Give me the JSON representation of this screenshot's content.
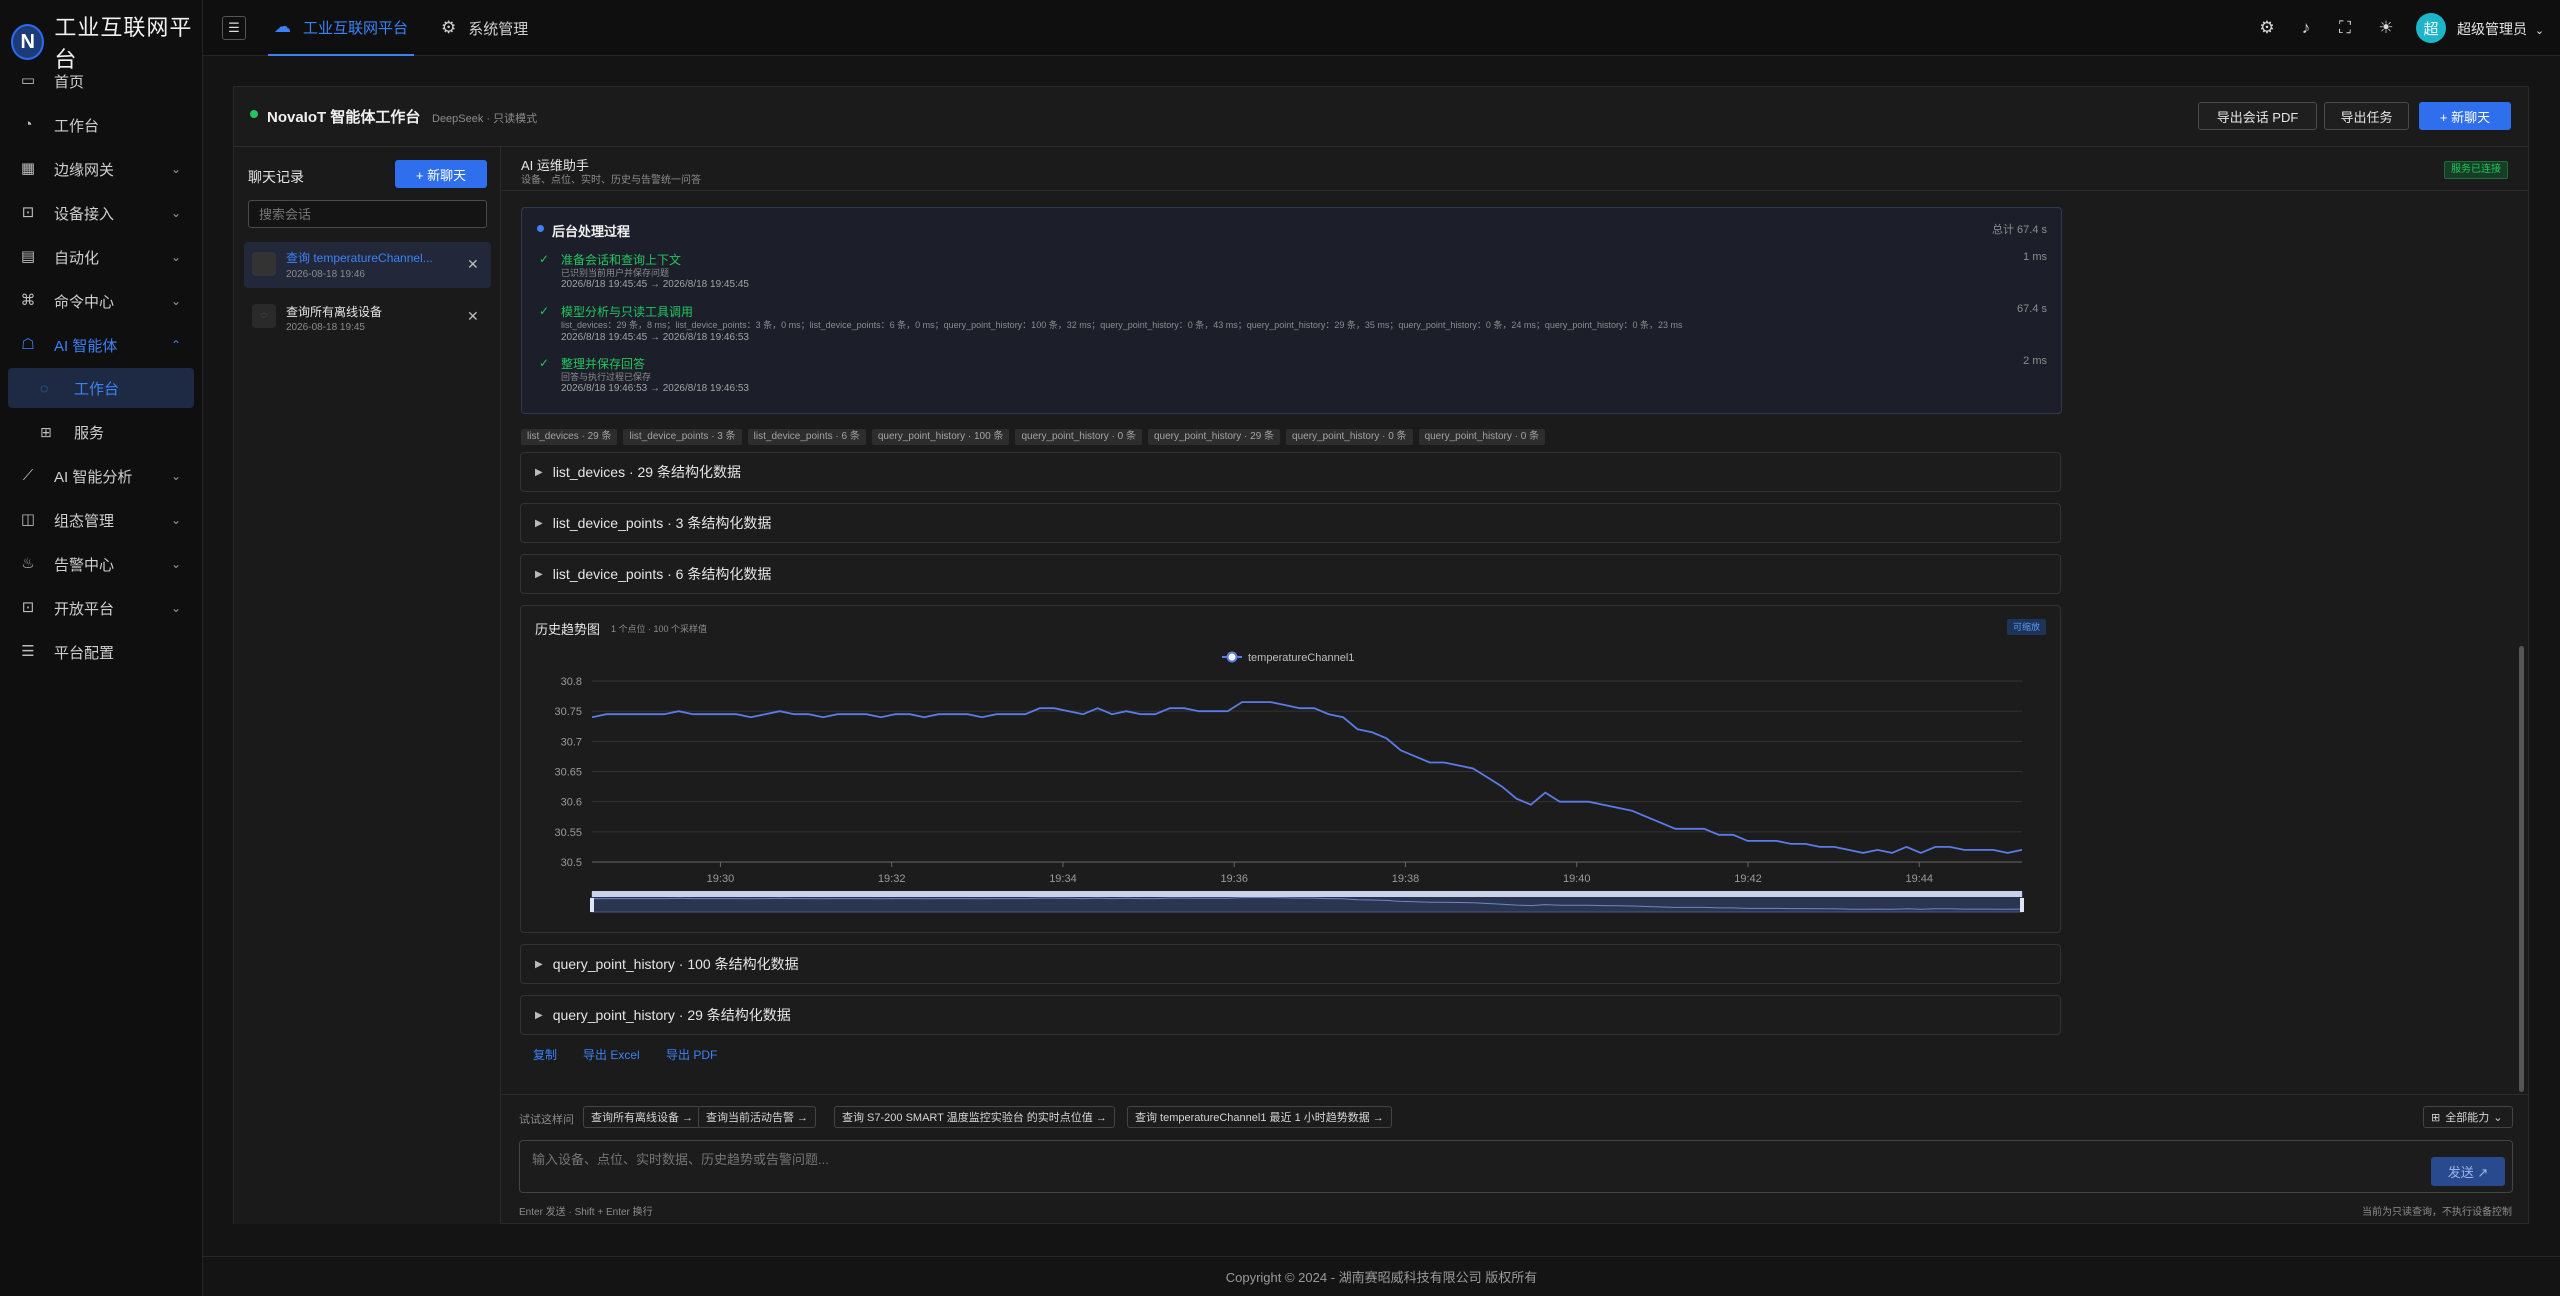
{
  "app": {
    "title": "工业互联网平台",
    "logo_letter": "N"
  },
  "sidebar": {
    "items": [
      {
        "label": "首页",
        "icon": "monitor-icon",
        "chevron": ""
      },
      {
        "label": "工作台",
        "icon": "dashboard-icon",
        "chevron": ""
      },
      {
        "label": "边缘网关",
        "icon": "gateway-icon",
        "chevron": "⌄"
      },
      {
        "label": "设备接入",
        "icon": "device-icon",
        "chevron": "⌄"
      },
      {
        "label": "自动化",
        "icon": "automation-icon",
        "chevron": "⌄"
      },
      {
        "label": "命令中心",
        "icon": "command-icon",
        "chevron": "⌄"
      },
      {
        "label": "AI 智能体",
        "icon": "robot-icon",
        "chevron": "⌃"
      },
      {
        "label": "AI 智能分析",
        "icon": "chart-line-icon",
        "chevron": "⌄"
      },
      {
        "label": "组态管理",
        "icon": "layout-icon",
        "chevron": "⌄"
      },
      {
        "label": "告警中心",
        "icon": "fire-icon",
        "chevron": "⌄"
      },
      {
        "label": "开放平台",
        "icon": "open-icon",
        "chevron": "⌄"
      },
      {
        "label": "平台配置",
        "icon": "sliders-icon",
        "chevron": ""
      }
    ],
    "sub_items": [
      {
        "label": "工作台",
        "icon": "chat-icon"
      },
      {
        "label": "服务",
        "icon": "service-icon"
      }
    ]
  },
  "topbar": {
    "tabs": [
      {
        "label": "工业互联网平台"
      },
      {
        "label": "系统管理"
      }
    ],
    "user": "超级管理员",
    "avatar_letter": "超"
  },
  "workspace": {
    "title": "NovaIoT 智能体工作台",
    "mode": "DeepSeek · 只读模式",
    "buttons": {
      "export_pdf": "导出会话 PDF",
      "export_task": "导出任务",
      "new_chat": "+ 新聊天"
    }
  },
  "chat_list": {
    "title": "聊天记录",
    "new_label": "+ 新聊天",
    "search_placeholder": "搜索会话",
    "items": [
      {
        "title": "查询 temperatureChannel...",
        "time": "2026-08-18 19:46"
      },
      {
        "title": "查询所有离线设备",
        "time": "2026-08-18 19:45"
      }
    ]
  },
  "assistant": {
    "title": "AI 运维助手",
    "subtitle": "设备、点位、实时、历史与告警统一问答",
    "status": "服务已连接"
  },
  "process": {
    "title": "后台处理过程",
    "total": "总计 67.4 s",
    "steps": [
      {
        "name": "准备会话和查询上下文",
        "desc": "已识别当前用户并保存问题",
        "time": "2026/8/18 19:45:45 → 2026/8/18 19:45:45",
        "duration": "1 ms"
      },
      {
        "name": "模型分析与只读工具调用",
        "desc": "list_devices：29 条，8 ms；list_device_points：3 条，0 ms；list_device_points：6 条，0 ms；query_point_history：100 条，32 ms；query_point_history：0 条，43 ms；query_point_history：29 条，35 ms；query_point_history：0 条，24 ms；query_point_history：0 条，23 ms",
        "time": "2026/8/18 19:45:45 → 2026/8/18 19:46:53",
        "duration": "67.4 s"
      },
      {
        "name": "整理并保存回答",
        "desc": "回答与执行过程已保存",
        "time": "2026/8/18 19:46:53 → 2026/8/18 19:46:53",
        "duration": "2 ms"
      }
    ]
  },
  "tool_chips": [
    "list_devices · 29 条",
    "list_device_points · 3 条",
    "list_device_points · 6 条",
    "query_point_history · 100 条",
    "query_point_history · 0 条",
    "query_point_history · 29 条",
    "query_point_history · 0 条",
    "query_point_history · 0 条"
  ],
  "collapses_top": [
    "list_devices · 29 条结构化数据",
    "list_device_points · 3 条结构化数据",
    "list_device_points · 6 条结构化数据"
  ],
  "collapses_bottom": [
    "query_point_history · 100 条结构化数据",
    "query_point_history · 29 条结构化数据"
  ],
  "history_chart": {
    "title": "历史趋势图",
    "subtitle": "1 个点位 · 100 个采样值",
    "badge": "可缩放"
  },
  "chart_data": {
    "type": "line",
    "title": "",
    "legend": [
      "temperatureChannel1"
    ],
    "ylim": [
      30.5,
      30.8
    ],
    "yticks": [
      "30.8",
      "30.75",
      "30.7",
      "30.65",
      "30.6",
      "30.55",
      "30.5"
    ],
    "xticks": [
      "19:30",
      "19:32",
      "19:34",
      "19:36",
      "19:38",
      "19:40",
      "19:42",
      "19:44"
    ],
    "series": [
      {
        "name": "temperatureChannel1",
        "color": "#5b7be8",
        "values": [
          30.74,
          30.745,
          30.745,
          30.745,
          30.745,
          30.745,
          30.75,
          30.745,
          30.745,
          30.745,
          30.745,
          30.74,
          30.745,
          30.75,
          30.745,
          30.745,
          30.74,
          30.745,
          30.745,
          30.745,
          30.74,
          30.745,
          30.745,
          30.74,
          30.745,
          30.745,
          30.745,
          30.74,
          30.745,
          30.745,
          30.745,
          30.755,
          30.755,
          30.75,
          30.745,
          30.755,
          30.745,
          30.75,
          30.745,
          30.745,
          30.755,
          30.755,
          30.75,
          30.75,
          30.75,
          30.765,
          30.765,
          30.765,
          30.76,
          30.755,
          30.755,
          30.745,
          30.74,
          30.72,
          30.715,
          30.705,
          30.685,
          30.675,
          30.665,
          30.665,
          30.66,
          30.655,
          30.64,
          30.625,
          30.605,
          30.595,
          30.615,
          30.6,
          30.6,
          30.6,
          30.595,
          30.59,
          30.585,
          30.575,
          30.565,
          30.555,
          30.555,
          30.555,
          30.545,
          30.545,
          30.535,
          30.535,
          30.535,
          30.53,
          30.53,
          30.525,
          30.525,
          30.52,
          30.515,
          30.52,
          30.515,
          30.525,
          30.515,
          30.525,
          30.525,
          30.52,
          30.52,
          30.52,
          30.515,
          30.52
        ]
      }
    ]
  },
  "actions": {
    "copy": "复制",
    "excel": "导出 Excel",
    "pdf": "导出 PDF"
  },
  "suggestions": {
    "label": "试试这样问",
    "items": [
      "查询所有离线设备 →",
      "查询当前活动告警 →",
      "查询 S7-200 SMART 温度监控实验台 的实时点位值 →",
      "查询 temperatureChannel1 最近 1 小时趋势数据 →"
    ],
    "capabilities": "全部能力"
  },
  "input": {
    "placeholder": "输入设备、点位、实时数据、历史趋势或告警问题...",
    "send": "发送 ↗",
    "hint": "Enter 发送 · Shift + Enter 换行",
    "notice": "当前为只读查询，不执行设备控制"
  },
  "footer": "Copyright © 2024 - 湖南赛昭威科技有限公司 版权所有"
}
